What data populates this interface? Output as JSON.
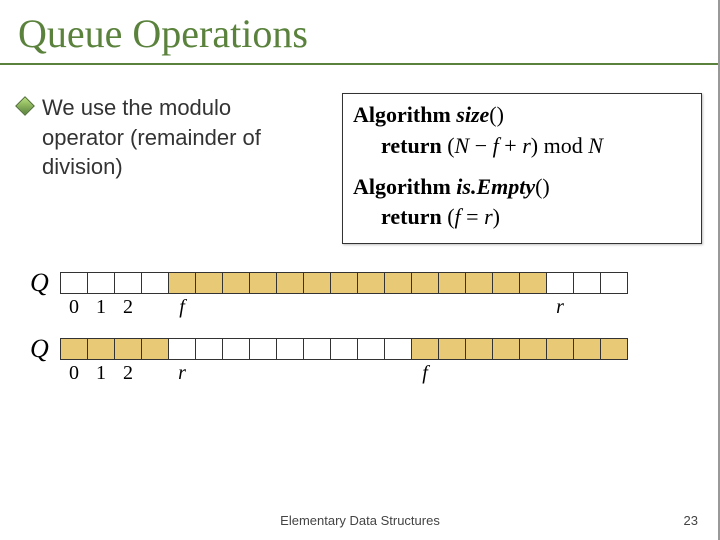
{
  "title": "Queue Operations",
  "bullet": "We use the modulo operator (remainder of division)",
  "algo1": {
    "kw": "Algorithm",
    "name": "size",
    "parens": "()",
    "ret_kw": "return",
    "ret_expr_open": "(",
    "ret_N": "N",
    "ret_minus": " − ",
    "ret_f": "f",
    "ret_plus": " + ",
    "ret_r": "r",
    "ret_close": ")",
    "ret_mod": " mod ",
    "ret_N2": "N"
  },
  "algo2": {
    "kw": "Algorithm",
    "name": "is.Empty",
    "parens": "()",
    "ret_kw": "return",
    "ret_open": "(",
    "ret_f": "f",
    "ret_eq": " = ",
    "ret_r": "r",
    "ret_close": ")"
  },
  "diagram1": {
    "q": "Q",
    "label0": "0",
    "label1": "1",
    "label2": "2",
    "label_f": "f",
    "label_r": "r"
  },
  "diagram2": {
    "q": "Q",
    "label0": "0",
    "label1": "1",
    "label2": "2",
    "label_r": "r",
    "label_f": "f"
  },
  "footer_center": "Elementary Data Structures",
  "footer_right": "23",
  "chart_data": [
    {
      "type": "table",
      "title": "Circular queue array state (case 1: f < r)",
      "n_cells": 21,
      "f_index": 4,
      "r_index": 18,
      "filled_indices": [
        4,
        5,
        6,
        7,
        8,
        9,
        10,
        11,
        12,
        13,
        14,
        15,
        16,
        17
      ],
      "labels_below": {
        "0": "0",
        "1": "1",
        "2": "2",
        "4": "f",
        "18": "r"
      }
    },
    {
      "type": "table",
      "title": "Circular queue array state (case 2: wrap-around, r < f)",
      "n_cells": 21,
      "f_index": 13,
      "r_index": 4,
      "filled_indices": [
        0,
        1,
        2,
        3,
        13,
        14,
        15,
        16,
        17,
        18,
        19,
        20
      ],
      "labels_below": {
        "0": "0",
        "1": "1",
        "2": "2",
        "4": "r",
        "13": "f"
      }
    }
  ]
}
